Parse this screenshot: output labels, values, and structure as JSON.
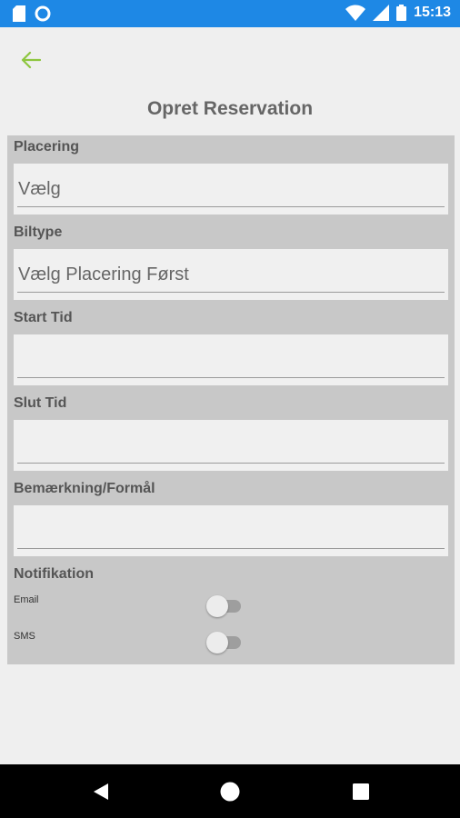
{
  "status_bar": {
    "time": "15:13",
    "left_icons": [
      "sd-card-icon",
      "sync-circle-icon"
    ],
    "right_icons": [
      "wifi-icon",
      "signal-icon",
      "battery-icon"
    ]
  },
  "header": {
    "title": "Opret Reservation",
    "accent_color": "#8dc63f"
  },
  "form": {
    "placering": {
      "label": "Placering",
      "value": "Vælg"
    },
    "biltype": {
      "label": "Biltype",
      "value": "Vælg Placering Først"
    },
    "start_tid": {
      "label": "Start Tid",
      "value": ""
    },
    "slut_tid": {
      "label": "Slut Tid",
      "value": ""
    },
    "bemaerkning": {
      "label": "Bemærkning/Formål",
      "value": ""
    }
  },
  "notifikation": {
    "label": "Notifikation",
    "email": {
      "label": "Email",
      "on": false
    },
    "sms": {
      "label": "SMS",
      "on": false
    }
  },
  "nav_bar": {
    "icons": [
      "back-triangle-icon",
      "home-circle-icon",
      "recents-square-icon"
    ]
  }
}
